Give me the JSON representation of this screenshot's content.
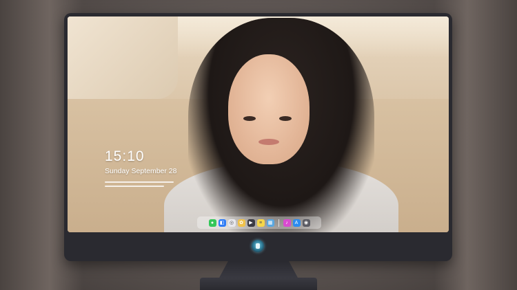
{
  "lock_screen": {
    "time": "15:10",
    "date": "Sunday September 28"
  },
  "dock": {
    "items": [
      {
        "name": "messages-icon",
        "color": "#34c759",
        "glyph": "●"
      },
      {
        "name": "finder-icon",
        "color": "#2f7cf6",
        "glyph": "◧"
      },
      {
        "name": "safari-icon",
        "color": "#e8e8ee",
        "glyph": "◎"
      },
      {
        "name": "photos-icon",
        "color": "#f0c24b",
        "glyph": "✿"
      },
      {
        "name": "video-icon",
        "color": "#3a3a44",
        "glyph": "▶"
      },
      {
        "name": "notes-icon",
        "color": "#f6d64a",
        "glyph": "≡"
      },
      {
        "name": "preview-icon",
        "color": "#5aa7e0",
        "glyph": "▦"
      },
      {
        "name": "music-icon",
        "color": "#d94ad0",
        "glyph": "♪"
      },
      {
        "name": "appstore-icon",
        "color": "#2d8cf0",
        "glyph": "A"
      },
      {
        "name": "camera-icon",
        "color": "#5b5b63",
        "glyph": "◉"
      }
    ]
  },
  "colors": {
    "bezel": "#2a2a30",
    "dock_bg": "rgba(255,255,255,0.35)",
    "text": "#ffffff"
  }
}
